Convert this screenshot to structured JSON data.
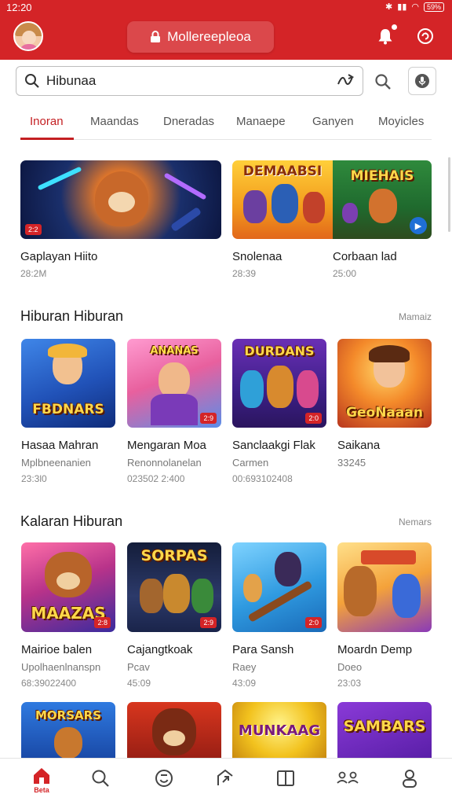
{
  "status_bar": {
    "time": "12:20",
    "battery": "59%"
  },
  "header": {
    "title": "Mollereepleoa"
  },
  "search": {
    "value": "Hibunaa",
    "placeholder": ""
  },
  "tabs": [
    "Inoran",
    "Maandas",
    "Dneradas",
    "Manaepe",
    "Ganyen",
    "Moyicles"
  ],
  "featured": [
    {
      "title": "Gaplayan Hiito",
      "meta": "28:2M",
      "badge": "2:2"
    },
    {
      "title": "Snolenaa",
      "meta": "28:39",
      "banner": "DEMAABSI"
    },
    {
      "title": "Corbaan lad",
      "meta": "25:00",
      "banner": "MIEHAIS"
    }
  ],
  "section1": {
    "title": "Hiburan Hiburan",
    "more": "Mamaiz",
    "items": [
      {
        "title": "Hasaa Mahran",
        "sub": "Mplbneenanien",
        "meta": "23:3l0",
        "banner": "FBDNARS",
        "badge": ""
      },
      {
        "title": "Mengaran Moa",
        "sub": "Renonnolanelan",
        "meta": "023502 2:400",
        "banner": "ANANAS",
        "badge": "2:9"
      },
      {
        "title": "Sanclaakgi Flak",
        "sub": "Carmen",
        "meta": "00:693102408",
        "banner": "DURDANS",
        "badge": "2:0"
      },
      {
        "title": "Saikana",
        "sub": "33245",
        "meta": "",
        "banner": "GeoNaaan",
        "badge": ""
      }
    ]
  },
  "section2": {
    "title": "Kalaran Hiburan",
    "more": "Nemars",
    "items": [
      {
        "title": "Mairioe balen",
        "sub": "Upolhaenlnanspn",
        "meta": "68:39022400",
        "banner": "MAAZAS",
        "badge": "2:8"
      },
      {
        "title": "Cajangtkoak",
        "sub": "Pcav",
        "meta": "45:09",
        "banner": "SORPAS",
        "badge": "2:9"
      },
      {
        "title": "Para Sansh",
        "sub": "Raey",
        "meta": "43:09",
        "banner": "",
        "badge": "2:0"
      },
      {
        "title": "Moardn Demp",
        "sub": "Doeo",
        "meta": "23:03",
        "banner": "",
        "badge": ""
      }
    ]
  },
  "section3_banners": [
    "MORSARS",
    "",
    "MUNKAAG",
    "SAMBARS"
  ],
  "bottom_nav": {
    "home_label": "Beta"
  },
  "colors": {
    "brand_red": "#d42427",
    "tab_active": "#c41f22"
  }
}
